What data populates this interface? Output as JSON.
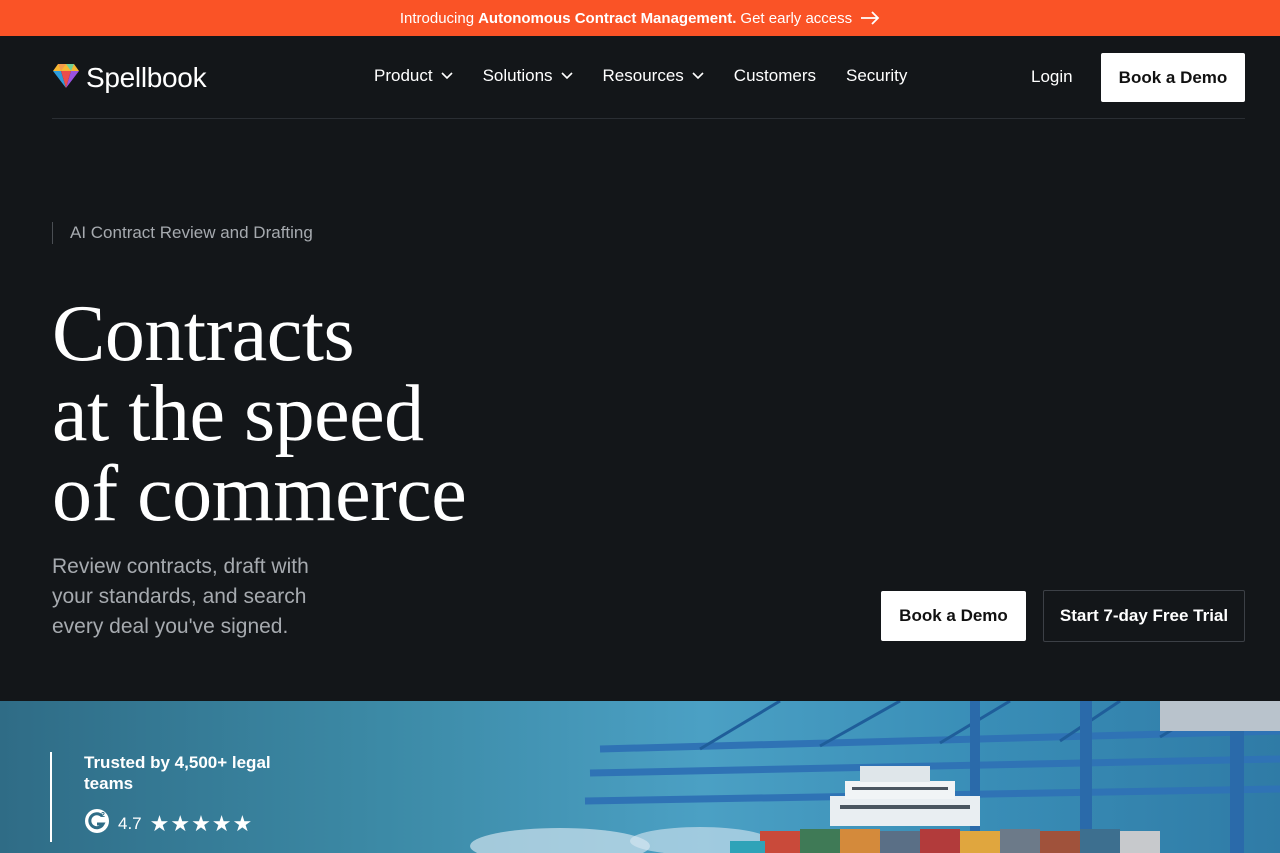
{
  "announcement": {
    "prefix": "Introducing",
    "highlight": "Autonomous Contract Management.",
    "cta": "Get early access",
    "arrow_icon": "arrow-right-icon"
  },
  "nav": {
    "brand": "Spellbook",
    "logo_icon": "gem-logo-icon",
    "links": [
      {
        "label": "Product",
        "has_dropdown": true
      },
      {
        "label": "Solutions",
        "has_dropdown": true
      },
      {
        "label": "Resources",
        "has_dropdown": true
      },
      {
        "label": "Customers",
        "has_dropdown": false
      },
      {
        "label": "Security",
        "has_dropdown": false
      }
    ],
    "login": "Login",
    "demo": "Book a Demo"
  },
  "hero": {
    "eyebrow": "AI Contract Review and Drafting",
    "headline": [
      "Contracts",
      "at the speed",
      "of commerce"
    ],
    "subtext": "Review contracts, draft with your standards, and search every deal you've signed.",
    "primary_cta": "Book a Demo",
    "secondary_cta": "Start 7-day Free Trial"
  },
  "trust": {
    "text": "Trusted by 4,500+ legal teams",
    "rating": "4.7",
    "stars": "★★★★★",
    "g2_icon": "g2-icon"
  },
  "colors": {
    "accent": "#fa5326",
    "background": "#131619",
    "muted_text": "#a6aaaf"
  }
}
